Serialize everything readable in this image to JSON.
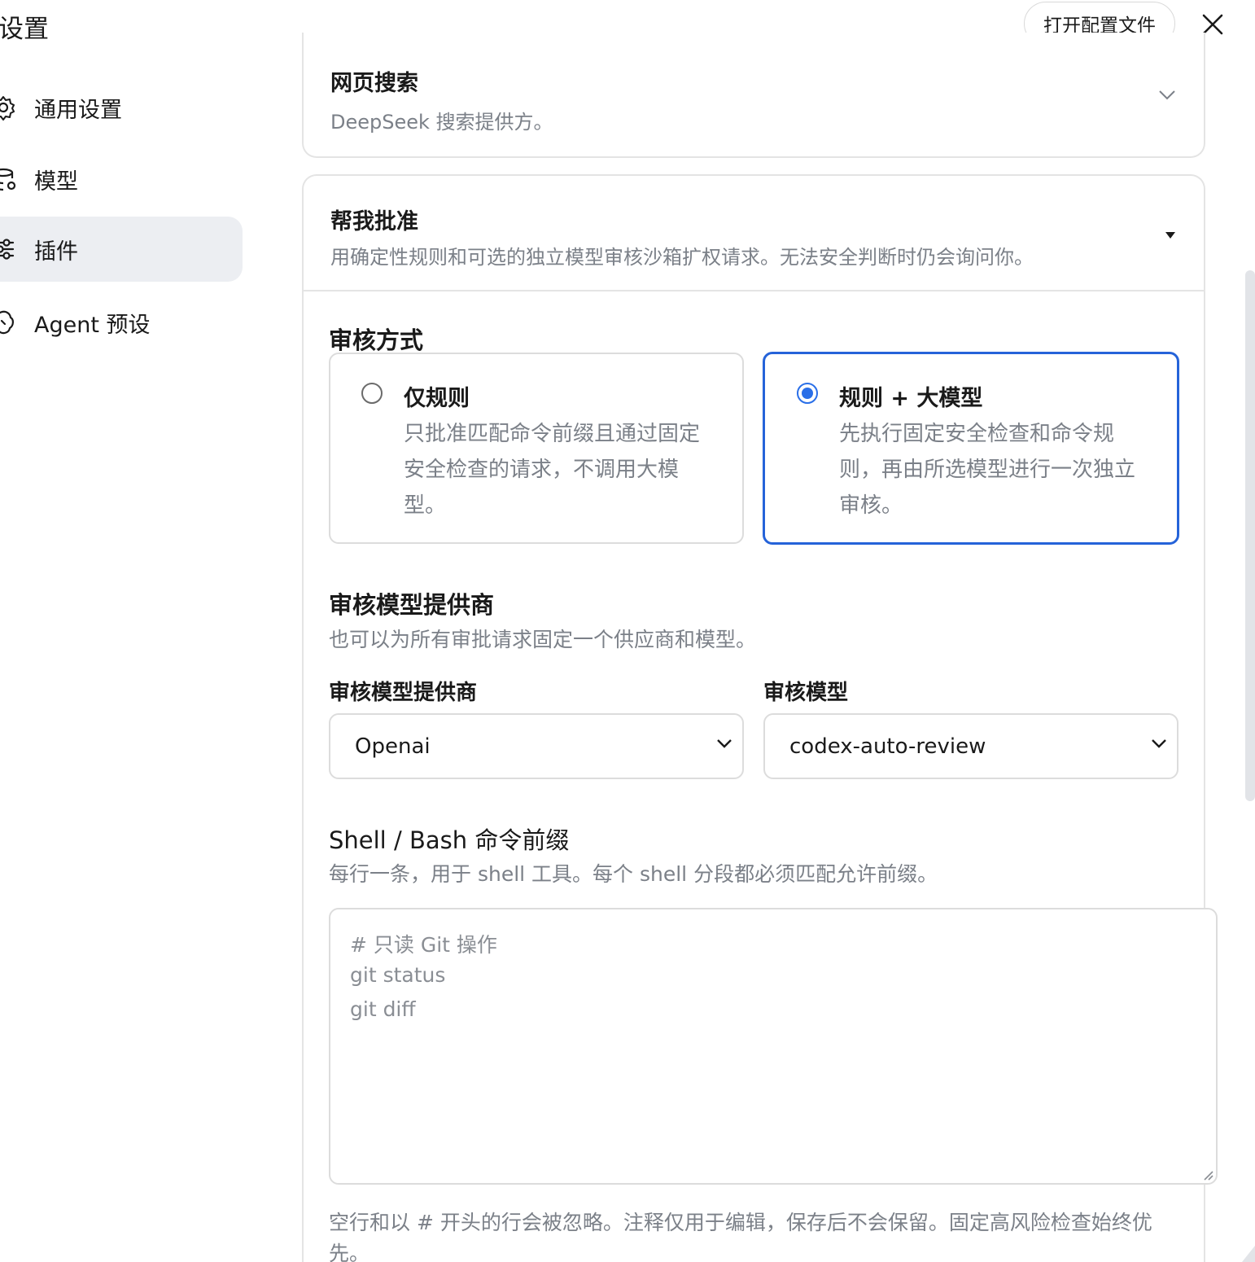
{
  "header": {
    "title": "设置",
    "open_config_label": "打开配置文件"
  },
  "sidebar": {
    "items": [
      {
        "label": "通用设置",
        "icon": "gear-icon",
        "active": false
      },
      {
        "label": "模型",
        "icon": "database-icon",
        "active": false
      },
      {
        "label": "插件",
        "icon": "sliders-icon",
        "active": true
      },
      {
        "label": "Agent 预设",
        "icon": "agent-icon",
        "active": false
      }
    ]
  },
  "web_search": {
    "title": "网页搜索",
    "description": "DeepSeek 搜索提供方。"
  },
  "approval": {
    "title": "帮我批准",
    "description": "用确定性规则和可选的独立模型审核沙箱扩权请求。无法安全判断时仍会询问你。",
    "review_mode": {
      "title": "审核方式",
      "options": [
        {
          "title": "仅规则",
          "description": "只批准匹配命令前缀且通过固定安全检查的请求，不调用大模型。",
          "selected": false
        },
        {
          "title": "规则 + 大模型",
          "description": "先执行固定安全检查和命令规则，再由所选模型进行一次独立审核。",
          "selected": true
        }
      ]
    },
    "provider_section": {
      "title": "审核模型提供商",
      "description": "也可以为所有审批请求固定一个供应商和模型。",
      "provider_label": "审核模型提供商",
      "provider_value": "Openai",
      "model_label": "审核模型",
      "model_value": "codex-auto-review"
    },
    "shell_prefix": {
      "title": "Shell / Bash 命令前缀",
      "description": "每行一条，用于 shell 工具。每个 shell 分段都必须匹配允许前缀。",
      "lines": [
        "# 只读 Git 操作",
        "git status",
        "git diff"
      ],
      "note": "空行和以 # 开头的行会被忽略。注释仅用于编辑，保存后不会保留。固定高风险检查始终优先。"
    }
  },
  "colors": {
    "accent": "#2563d9",
    "muted_text": "#7b8088",
    "border": "#e4e4e4",
    "active_bg": "#eceef2"
  }
}
